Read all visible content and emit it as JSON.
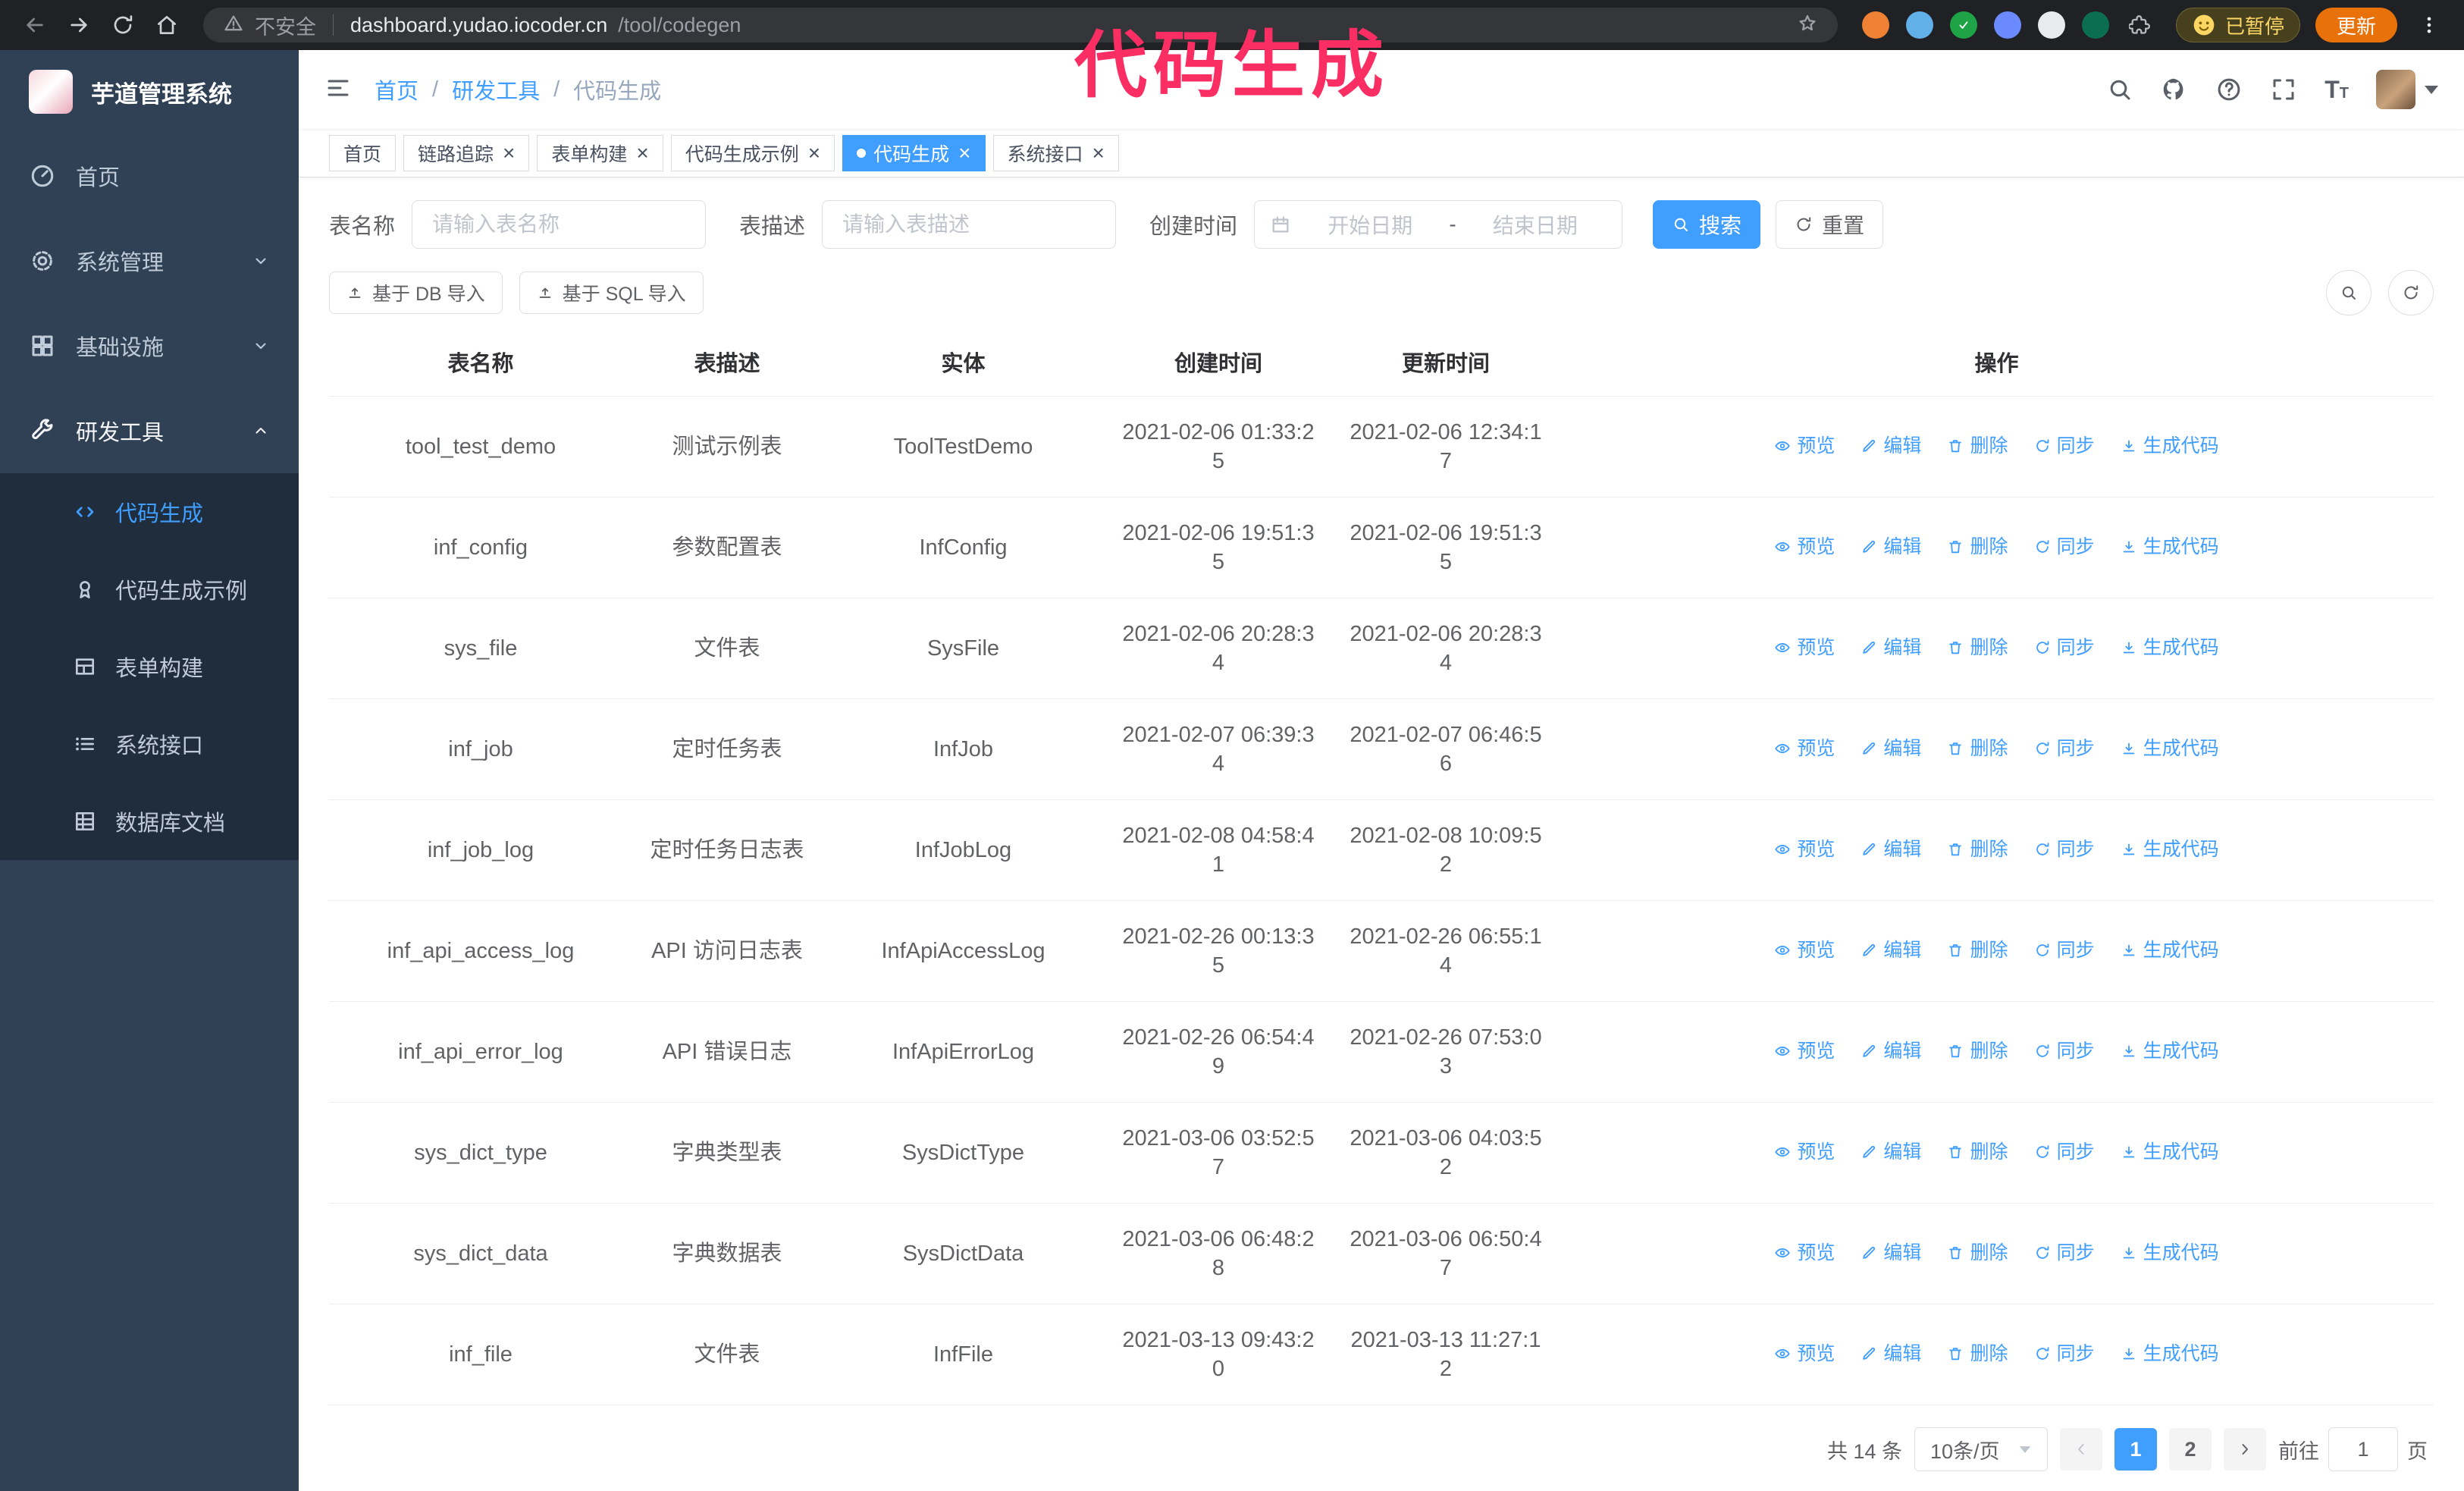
{
  "browser": {
    "security_label": "不安全",
    "url_host": "dashboard.yudao.iocoder.cn",
    "url_path": "/tool/codegen",
    "paused_badge": "已暂停",
    "update_button": "更新"
  },
  "annotation": "代码生成",
  "sidebar": {
    "app_title": "芋道管理系统",
    "items": [
      {
        "label": "首页",
        "icon": "dashboard-icon"
      },
      {
        "label": "系统管理",
        "icon": "gear-icon",
        "chevron": "down"
      },
      {
        "label": "基础设施",
        "icon": "infra-icon",
        "chevron": "down"
      },
      {
        "label": "研发工具",
        "icon": "tools-icon",
        "chevron": "up",
        "expanded": true
      }
    ],
    "subitems": [
      {
        "label": "代码生成",
        "icon": "code-icon",
        "active": true
      },
      {
        "label": "代码生成示例",
        "icon": "example-icon"
      },
      {
        "label": "表单构建",
        "icon": "form-icon"
      },
      {
        "label": "系统接口",
        "icon": "api-icon"
      },
      {
        "label": "数据库文档",
        "icon": "db-doc-icon"
      }
    ]
  },
  "header": {
    "breadcrumb": [
      "首页",
      "研发工具",
      "代码生成"
    ]
  },
  "tabs": [
    {
      "label": "首页",
      "closable": false,
      "active": false
    },
    {
      "label": "链路追踪",
      "closable": true,
      "active": false
    },
    {
      "label": "表单构建",
      "closable": true,
      "active": false
    },
    {
      "label": "代码生成示例",
      "closable": true,
      "active": false
    },
    {
      "label": "代码生成",
      "closable": true,
      "active": true
    },
    {
      "label": "系统接口",
      "closable": true,
      "active": false
    }
  ],
  "filters": {
    "table_name_label": "表名称",
    "table_name_placeholder": "请输入表名称",
    "table_desc_label": "表描述",
    "table_desc_placeholder": "请输入表描述",
    "create_time_label": "创建时间",
    "start_date_placeholder": "开始日期",
    "range_separator": "-",
    "end_date_placeholder": "结束日期",
    "search_button": "搜索",
    "reset_button": "重置"
  },
  "toolbar": {
    "import_db_button": "基于 DB 导入",
    "import_sql_button": "基于 SQL 导入"
  },
  "table": {
    "columns": [
      "表名称",
      "表描述",
      "实体",
      "创建时间",
      "更新时间",
      "操作"
    ],
    "actions": [
      "预览",
      "编辑",
      "删除",
      "同步",
      "生成代码"
    ],
    "rows": [
      {
        "name": "tool_test_demo",
        "desc": "测试示例表",
        "entity": "ToolTestDemo",
        "created": "2021-02-06 01:33:25",
        "updated": "2021-02-06 12:34:17"
      },
      {
        "name": "inf_config",
        "desc": "参数配置表",
        "entity": "InfConfig",
        "created": "2021-02-06 19:51:35",
        "updated": "2021-02-06 19:51:35"
      },
      {
        "name": "sys_file",
        "desc": "文件表",
        "entity": "SysFile",
        "created": "2021-02-06 20:28:34",
        "updated": "2021-02-06 20:28:34"
      },
      {
        "name": "inf_job",
        "desc": "定时任务表",
        "entity": "InfJob",
        "created": "2021-02-07 06:39:34",
        "updated": "2021-02-07 06:46:56"
      },
      {
        "name": "inf_job_log",
        "desc": "定时任务日志表",
        "entity": "InfJobLog",
        "created": "2021-02-08 04:58:41",
        "updated": "2021-02-08 10:09:52"
      },
      {
        "name": "inf_api_access_log",
        "desc": "API 访问日志表",
        "entity": "InfApiAccessLog",
        "created": "2021-02-26 00:13:35",
        "updated": "2021-02-26 06:55:14"
      },
      {
        "name": "inf_api_error_log",
        "desc": "API 错误日志",
        "entity": "InfApiErrorLog",
        "created": "2021-02-26 06:54:49",
        "updated": "2021-02-26 07:53:03"
      },
      {
        "name": "sys_dict_type",
        "desc": "字典类型表",
        "entity": "SysDictType",
        "created": "2021-03-06 03:52:57",
        "updated": "2021-03-06 04:03:52"
      },
      {
        "name": "sys_dict_data",
        "desc": "字典数据表",
        "entity": "SysDictData",
        "created": "2021-03-06 06:48:28",
        "updated": "2021-03-06 06:50:47"
      },
      {
        "name": "inf_file",
        "desc": "文件表",
        "entity": "InfFile",
        "created": "2021-03-13 09:43:20",
        "updated": "2021-03-13 11:27:12"
      }
    ]
  },
  "pagination": {
    "total_text": "共 14 条",
    "page_size": "10条/页",
    "pages": [
      "1",
      "2"
    ],
    "active_page": "1",
    "goto_label": "前往",
    "goto_value": "1",
    "goto_unit": "页"
  },
  "colors": {
    "accent": "#409eff",
    "sidebar_bg": "#304156",
    "submenu_bg": "#1f2d3d",
    "annotation": "#fb2e63",
    "chrome_bg": "#202124"
  },
  "icons": {
    "back-icon": "←",
    "forward-icon": "→",
    "reload-icon": "⟳",
    "home-icon": "⌂",
    "warning-icon": "⚠",
    "star-icon": "☆",
    "extensions-puzzle-icon": "puzzle",
    "kebab-menu-icon": "⋮",
    "hamburger-icon": "≡",
    "search-icon": "magnifier",
    "github-icon": "octocat",
    "question-icon": "?",
    "fullscreen-icon": "⛶",
    "font-size-icon": "T",
    "caret-down-icon": "▾",
    "dashboard-icon": "gauge",
    "gear-icon": "⚙",
    "infra-icon": "grid",
    "tools-icon": "wrench",
    "code-icon": "</>",
    "example-icon": "medal",
    "form-icon": "form",
    "api-icon": "list",
    "db-doc-icon": "table",
    "calendar-icon": "calendar",
    "refresh-icon": "⟳",
    "upload-icon": "↑",
    "eye-icon": "eye",
    "edit-icon": "✎",
    "delete-icon": "trash",
    "sync-icon": "⟳",
    "download-icon": "↓",
    "prev-icon": "‹",
    "next-icon": "›"
  }
}
